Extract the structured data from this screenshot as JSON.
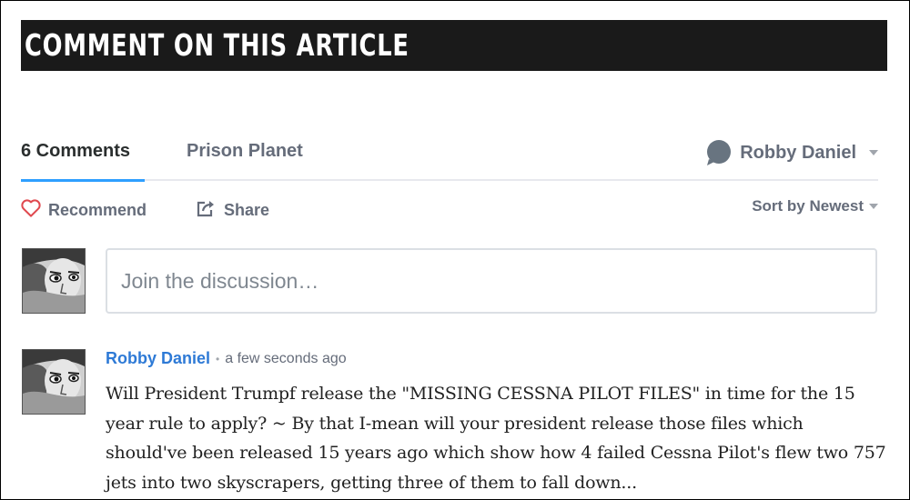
{
  "banner": {
    "title": "COMMENT ON THIS ARTICLE"
  },
  "nav": {
    "comments_tab": "6 Comments",
    "forum_tab": "Prison Planet",
    "user_name": "Robby Daniel"
  },
  "actions": {
    "recommend": "Recommend",
    "share": "Share",
    "sort": "Sort by Newest"
  },
  "composer": {
    "placeholder": "Join the discussion…"
  },
  "post": {
    "author": "Robby Daniel",
    "bullet": "•",
    "time": "a few seconds ago",
    "body": "Will President Trumpf release the \"MISSING CESSNA PILOT FILES\" in time for the 15 year rule to apply? ~ By that I-mean will your president release those files which should've been released 15 years ago which show how 4 failed Cessna Pilot's flew two 757 jets into two skyscrapers, getting three of them to fall down..."
  },
  "icons": {
    "recommend": "heart-icon",
    "share": "share-icon",
    "user": "user-avatar-icon",
    "caret": "chevron-down-icon"
  },
  "colors": {
    "banner_bg": "#1a1a1a",
    "accent_blue": "#2e9fff",
    "author_link": "#2e7ad6",
    "heart": "#e0494f",
    "muted_text": "#656c7a"
  }
}
